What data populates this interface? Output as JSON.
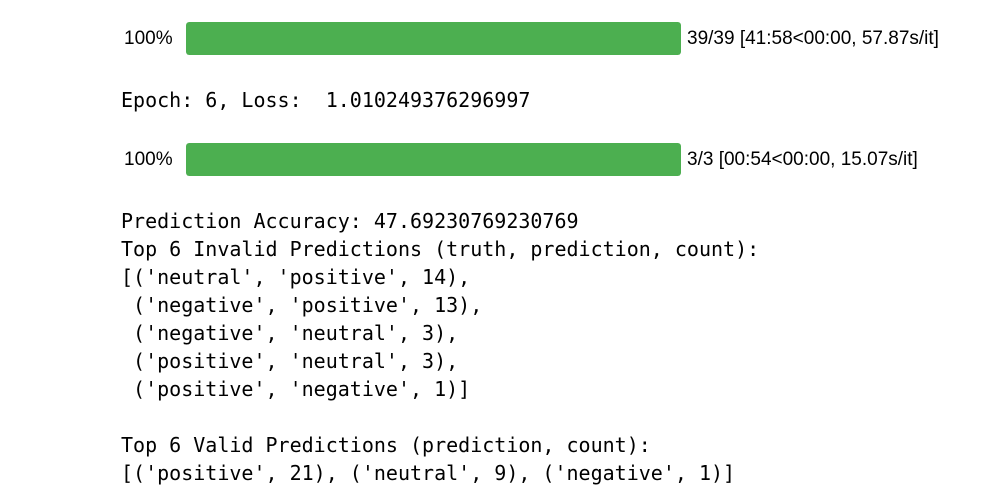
{
  "progress_bars": [
    {
      "percent_label": "100%",
      "fraction": 1.0,
      "stats": "39/39 [41:58<00:00, 57.87s/it]",
      "color": "#4caf50"
    },
    {
      "percent_label": "100%",
      "fraction": 1.0,
      "stats": "3/3 [00:54<00:00, 15.07s/it]",
      "color": "#4caf50"
    }
  ],
  "output": {
    "epoch_line": "Epoch: 6, Loss:  1.010249376296997",
    "accuracy_line": "Prediction Accuracy: 47.69230769230769",
    "invalid_header": "Top 6 Invalid Predictions (truth, prediction, count):",
    "invalid_rows": [
      "[('neutral', 'positive', 14),",
      " ('negative', 'positive', 13),",
      " ('negative', 'neutral', 3),",
      " ('positive', 'neutral', 3),",
      " ('positive', 'negative', 1)]"
    ],
    "valid_header": "Top 6 Valid Predictions (prediction, count):",
    "valid_row": "[('positive', 21), ('neutral', 9), ('negative', 1)]"
  }
}
